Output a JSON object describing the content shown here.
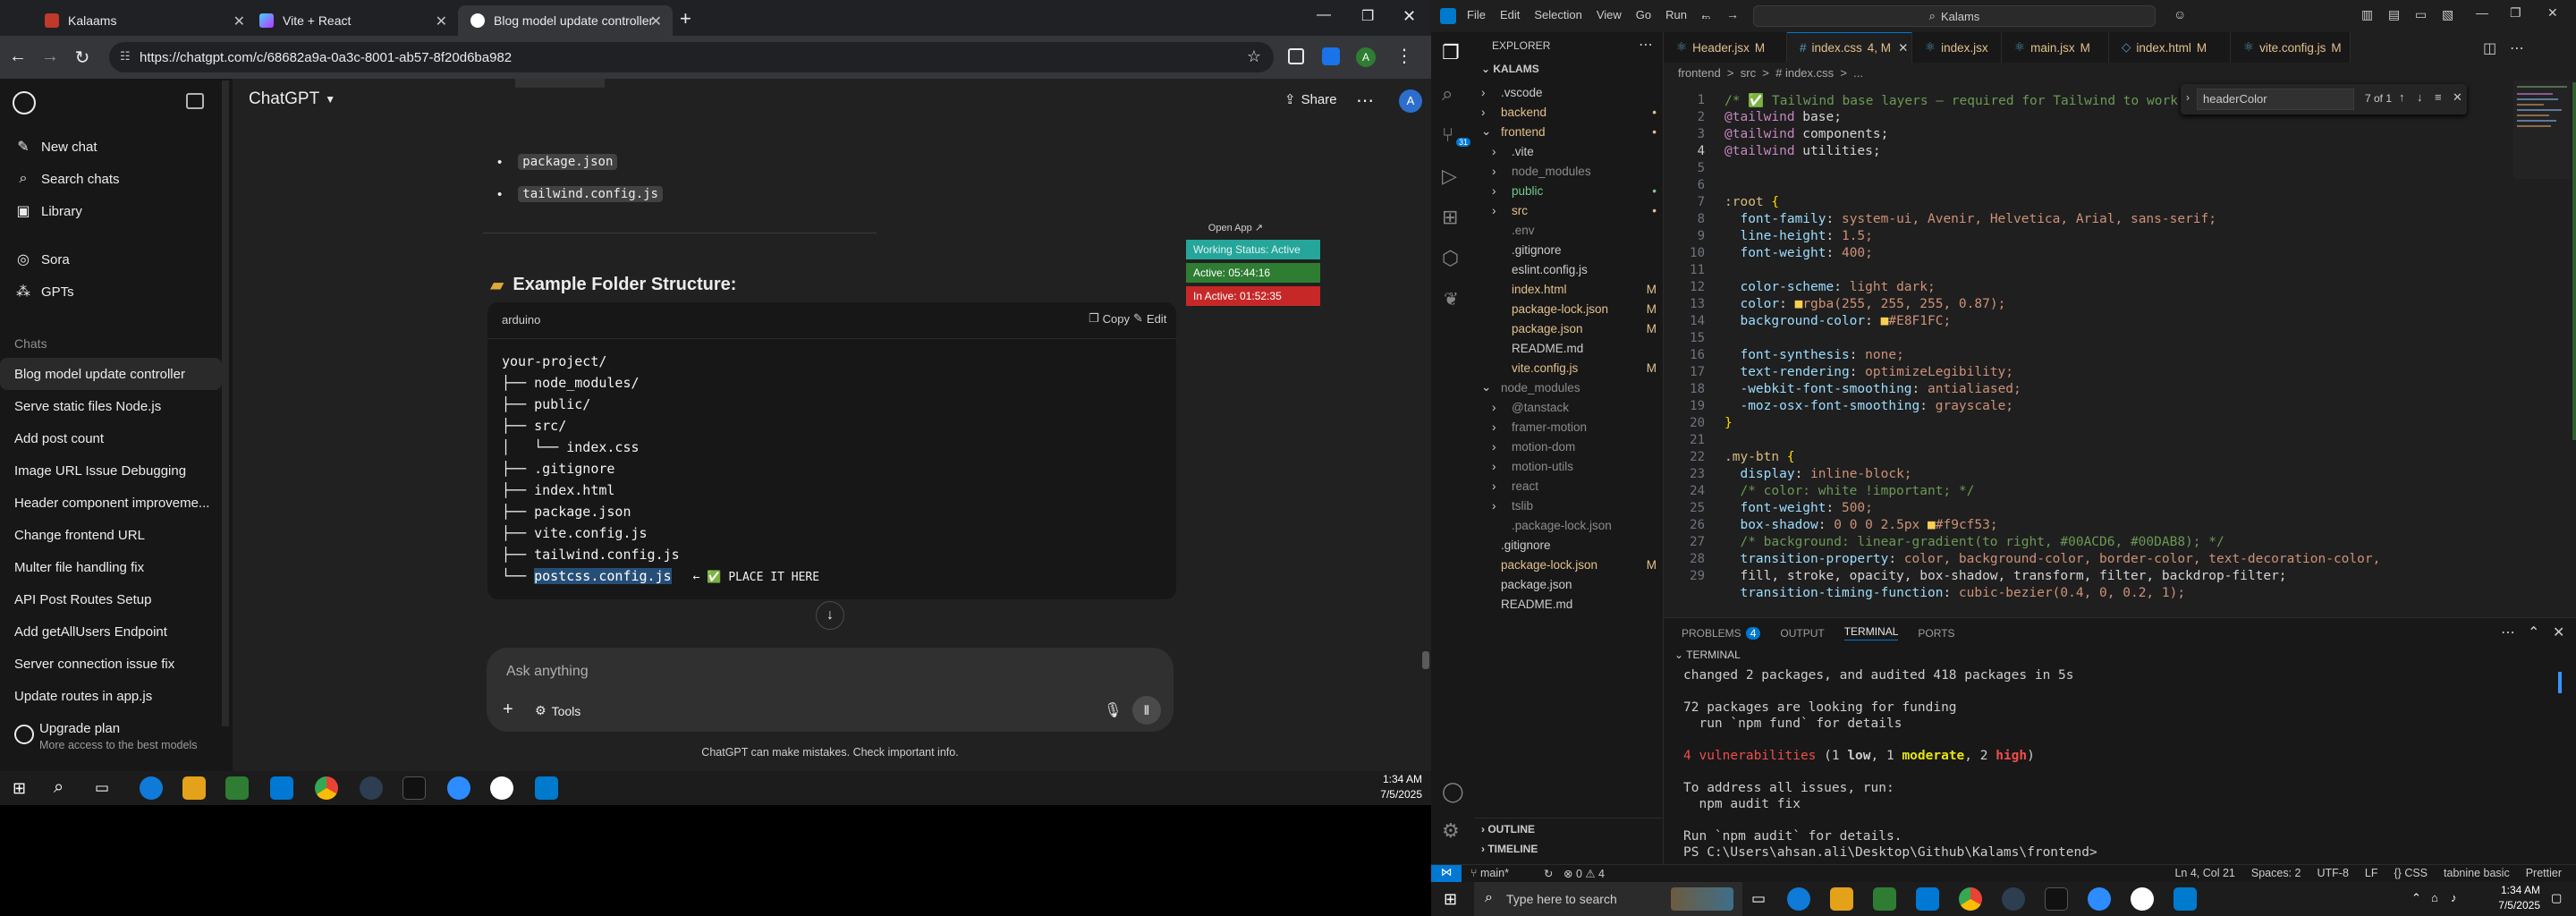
{
  "chrome": {
    "tabs": [
      {
        "title": "Kalaams"
      },
      {
        "title": "Vite + React"
      },
      {
        "title": "Blog model update controller"
      }
    ],
    "url": "https://chatgpt.com/c/68682a9a-0a3c-8001-ab57-8f20d6ba982"
  },
  "chatgpt": {
    "header_title": "ChatGPT",
    "share_label": "Share",
    "avatar": "A",
    "nav": [
      "New chat",
      "Search chats",
      "Library",
      "Sora",
      "GPTs"
    ],
    "chats_heading": "Chats",
    "chats": [
      "Blog model update controller",
      "Serve static files Node.js",
      "Add post count",
      "Image URL Issue Debugging",
      "Header component improveme...",
      "Change frontend URL",
      "Multer file handling fix",
      "API Post Routes Setup",
      "Add getAllUsers Endpoint",
      "Server connection issue fix",
      "Update routes in app.js"
    ],
    "upgrade_title": "Upgrade plan",
    "upgrade_sub": "More access to the best models",
    "bullets": [
      "package.json",
      "tailwind.config.js"
    ],
    "section_heading": "Example Folder Structure:",
    "open_app": "Open App ↗",
    "lang": "arduino",
    "copy": "Copy",
    "edit": "Edit",
    "tree": [
      "your-project/",
      "├── node_modules/",
      "├── public/",
      "├── src/",
      "│   └── index.css",
      "├── .gitignore",
      "├── index.html",
      "├── package.json",
      "├── vite.config.js",
      "├── tailwind.config.js",
      "└── postcss.config.js"
    ],
    "place_it": "← ✅ PLACE IT HERE",
    "input_placeholder": "Ask anything",
    "tools": "Tools",
    "disclaimer": "ChatGPT can make mistakes. Check important info."
  },
  "widget": {
    "status": "Working Status: Active",
    "active": "Active: 05:44:16",
    "inactive": "In Active: 01:52:35"
  },
  "taskbar1": {
    "time": "1:34 AM",
    "date": "7/5/2025"
  },
  "vscode": {
    "menu": [
      "File",
      "Edit",
      "Selection",
      "View",
      "Go",
      "Run",
      "..."
    ],
    "search": "Kalams",
    "explorer_title": "EXPLORER",
    "root": "KALAMS",
    "tree": [
      {
        "name": ".vscode",
        "depth": 1,
        "type": "folder",
        "color": "#cccccc",
        "mark": ""
      },
      {
        "name": "backend",
        "depth": 1,
        "type": "folder",
        "color": "#e2c08d",
        "mark": "•"
      },
      {
        "name": "frontend",
        "depth": 1,
        "type": "folder-open",
        "color": "#e2c08d",
        "mark": "•"
      },
      {
        "name": ".vite",
        "depth": 2,
        "type": "folder",
        "color": "#cccccc",
        "mark": ""
      },
      {
        "name": "node_modules",
        "depth": 2,
        "type": "folder",
        "color": "#8c8c8c",
        "mark": ""
      },
      {
        "name": "public",
        "depth": 2,
        "type": "folder",
        "color": "#73c991",
        "mark": "•"
      },
      {
        "name": "src",
        "depth": 2,
        "type": "folder",
        "color": "#e2c08d",
        "mark": "•"
      },
      {
        "name": ".env",
        "depth": 2,
        "type": "file",
        "color": "#8c8c8c",
        "mark": ""
      },
      {
        "name": ".gitignore",
        "depth": 2,
        "type": "file",
        "color": "#cccccc",
        "mark": ""
      },
      {
        "name": "eslint.config.js",
        "depth": 2,
        "type": "file",
        "color": "#cccccc",
        "mark": ""
      },
      {
        "name": "index.html",
        "depth": 2,
        "type": "file",
        "color": "#e2c08d",
        "mark": "M"
      },
      {
        "name": "package-lock.json",
        "depth": 2,
        "type": "file",
        "color": "#e2c08d",
        "mark": "M"
      },
      {
        "name": "package.json",
        "depth": 2,
        "type": "file",
        "color": "#e2c08d",
        "mark": "M"
      },
      {
        "name": "README.md",
        "depth": 2,
        "type": "file",
        "color": "#cccccc",
        "mark": ""
      },
      {
        "name": "vite.config.js",
        "depth": 2,
        "type": "file",
        "color": "#e2c08d",
        "mark": "M"
      },
      {
        "name": "node_modules",
        "depth": 1,
        "type": "folder-open",
        "color": "#8c8c8c",
        "mark": ""
      },
      {
        "name": "@tanstack",
        "depth": 2,
        "type": "folder",
        "color": "#8c8c8c",
        "mark": ""
      },
      {
        "name": "framer-motion",
        "depth": 2,
        "type": "folder",
        "color": "#8c8c8c",
        "mark": ""
      },
      {
        "name": "motion-dom",
        "depth": 2,
        "type": "folder",
        "color": "#8c8c8c",
        "mark": ""
      },
      {
        "name": "motion-utils",
        "depth": 2,
        "type": "folder",
        "color": "#8c8c8c",
        "mark": ""
      },
      {
        "name": "react",
        "depth": 2,
        "type": "folder",
        "color": "#8c8c8c",
        "mark": ""
      },
      {
        "name": "tslib",
        "depth": 2,
        "type": "folder",
        "color": "#8c8c8c",
        "mark": ""
      },
      {
        "name": ".package-lock.json",
        "depth": 2,
        "type": "file",
        "color": "#8c8c8c",
        "mark": ""
      },
      {
        "name": ".gitignore",
        "depth": 1,
        "type": "file",
        "color": "#cccccc",
        "mark": ""
      },
      {
        "name": "package-lock.json",
        "depth": 1,
        "type": "file",
        "color": "#e2c08d",
        "mark": "M"
      },
      {
        "name": "package.json",
        "depth": 1,
        "type": "file",
        "color": "#cccccc",
        "mark": ""
      },
      {
        "name": "README.md",
        "depth": 1,
        "type": "file",
        "color": "#cccccc",
        "mark": ""
      }
    ],
    "outline": "OUTLINE",
    "timeline": "TIMELINE",
    "tabs": [
      {
        "name": "Header.jsx",
        "mark": "M",
        "active": false
      },
      {
        "name": "index.css",
        "mark": "4, M",
        "active": true
      },
      {
        "name": "index.jsx",
        "mark": "",
        "active": false
      },
      {
        "name": "main.jsx",
        "mark": "M",
        "active": false
      },
      {
        "name": "index.html",
        "mark": "M",
        "active": false
      },
      {
        "name": "vite.config.js",
        "mark": "M",
        "active": false
      }
    ],
    "breadcrumb": "frontend  >  src  >  # index.css  >  ...",
    "find_text": "headerColor",
    "find_count": "7 of 1",
    "line_numbers": [
      "1",
      "2",
      "3",
      "4",
      "5",
      "6",
      "7",
      "8",
      "9",
      "10",
      "11",
      "12",
      "13",
      "14",
      "15",
      "16",
      "17",
      "18",
      "19",
      "20",
      "21",
      "22",
      "23",
      "24",
      "25",
      "26",
      "27",
      "28",
      "29"
    ],
    "code": [
      "/* ✅ Tailwind base layers — required for Tailwind to work */",
      "@tailwind base;",
      "@tailwind components;",
      "@tailwind utilities;",
      "",
      "",
      ":root {",
      "  font-family: system-ui, Avenir, Helvetica, Arial, sans-serif;",
      "  line-height: 1.5;",
      "  font-weight: 400;",
      "",
      "  color-scheme: light dark;",
      "  color: ■rgba(255, 255, 255, 0.87);",
      "  background-color: ■#E8F1FC;",
      "",
      "  font-synthesis: none;",
      "  text-rendering: optimizeLegibility;",
      "  -webkit-font-smoothing: antialiased;",
      "  -moz-osx-font-smoothing: grayscale;",
      "}",
      "",
      ".my-btn {",
      "  display: inline-block;",
      "  /* color: white !important; */",
      "  font-weight: 500;",
      "  box-shadow: 0 0 0 2.5px ■#f9cf53;",
      "  /* background: linear-gradient(to right, #00ACD6, #00DAB8); */",
      "  transition-property: color, background-color, border-color, text-decoration-color,",
      "  fill, stroke, opacity, box-shadow, transform, filter, backdrop-filter;"
    ],
    "code_extra": "  transition-timing-function: cubic-bezier(0.4, 0, 0.2, 1);",
    "panel_tabs": [
      "PROBLEMS",
      "OUTPUT",
      "TERMINAL",
      "PORTS"
    ],
    "problems_count": "4",
    "terminal_label": "TERMINAL",
    "terminal": [
      "changed 2 packages, and audited 418 packages in 5s",
      "",
      "72 packages are looking for funding",
      "  run `npm fund` for details",
      "",
      "4 vulnerabilities (1 low, 1 moderate, 2 high)",
      "",
      "To address all issues, run:",
      "  npm audit fix",
      "",
      "Run `npm audit` for details.",
      "PS C:\\Users\\ahsan.ali\\Desktop\\Github\\Kalams\\frontend> "
    ],
    "status_left": [
      "main*",
      "⊗ 0 ⚠ 4"
    ],
    "status_right": [
      "Ln 4, Col 21",
      "Spaces: 2",
      "UTF-8",
      "LF",
      "{} CSS",
      "tabnine basic",
      "Prettier"
    ]
  },
  "taskbar2": {
    "search": "Type here to search",
    "time": "1:34 AM",
    "date": "7/5/2025"
  }
}
